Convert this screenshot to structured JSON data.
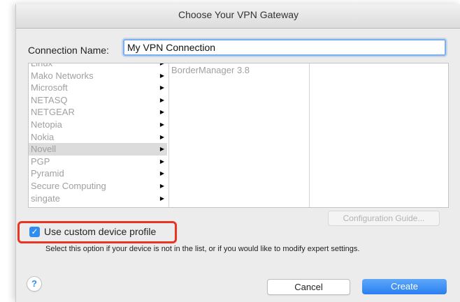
{
  "window": {
    "title": "Choose Your VPN Gateway"
  },
  "connection": {
    "label": "Connection Name:",
    "value": "My VPN Connection"
  },
  "vendors": [
    {
      "label": "Linux",
      "selected": false
    },
    {
      "label": "Mako Networks",
      "selected": false
    },
    {
      "label": "Microsoft",
      "selected": false
    },
    {
      "label": "NETASQ",
      "selected": false
    },
    {
      "label": "NETGEAR",
      "selected": false
    },
    {
      "label": "Netopia",
      "selected": false
    },
    {
      "label": "Nokia",
      "selected": false
    },
    {
      "label": "Novell",
      "selected": true
    },
    {
      "label": "PGP",
      "selected": false
    },
    {
      "label": "Pyramid",
      "selected": false
    },
    {
      "label": "Secure Computing",
      "selected": false
    },
    {
      "label": "singate",
      "selected": false
    }
  ],
  "arrow_glyph": "▶",
  "products": [
    "BorderManager 3.8"
  ],
  "config_guide": {
    "label": "Configuration Guide..."
  },
  "custom_profile": {
    "checked": true,
    "label": "Use custom device profile",
    "help": "Select this option if your device is not in the list, or if you would like to modify expert settings."
  },
  "help_button": {
    "label": "?"
  },
  "buttons": {
    "cancel": "Cancel",
    "create": "Create"
  },
  "colors": {
    "accent": "#2f8cf0",
    "highlight": "#ea3322"
  }
}
